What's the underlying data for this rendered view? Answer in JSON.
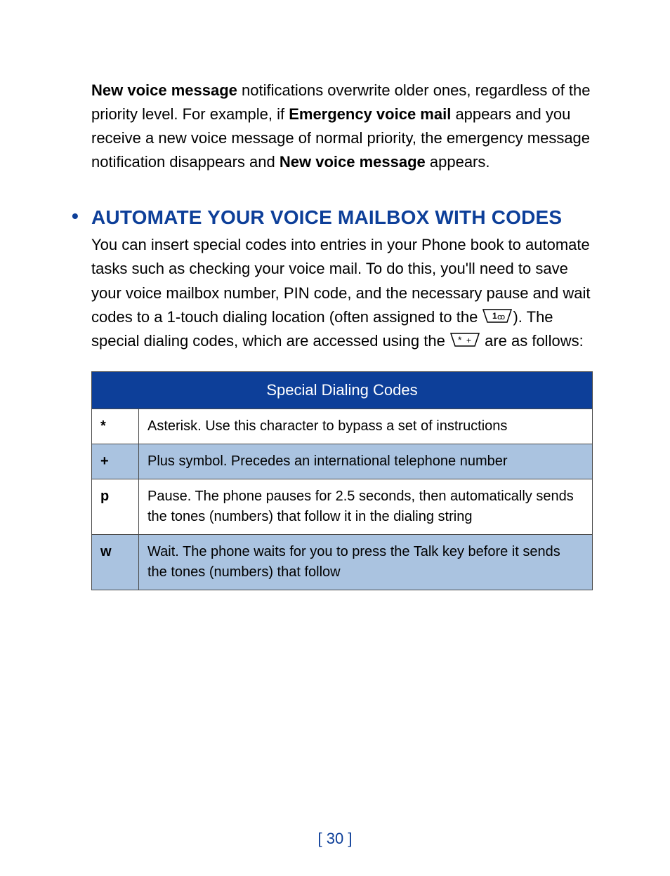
{
  "intro": {
    "seg1_bold": "New voice message",
    "seg2": " notifications overwrite older ones, regardless of the priority level. For example, if ",
    "seg3_bold": "Emergency voice mail",
    "seg4": " appears and you receive a new voice message of normal priority, the emergency message notification disappears and ",
    "seg5_bold": "New voice message",
    "seg6": " appears."
  },
  "section": {
    "heading": "AUTOMATE YOUR VOICE MAILBOX WITH CODES",
    "body_pre": "You can insert special codes into entries in your Phone book to automate tasks such as checking your voice mail. To do this, you'll need to save your voice mailbox number, PIN code, and the necessary pause and wait codes to a 1-touch dialing location (often assigned to the ",
    "body_mid": "). The special dialing codes, which are accessed using the ",
    "body_post": " are as follows:"
  },
  "table": {
    "header": "Special Dialing Codes",
    "rows": [
      {
        "code": "*",
        "desc": "Asterisk. Use this character to bypass a set of instructions"
      },
      {
        "code": "+",
        "desc": "Plus symbol. Precedes an international telephone number"
      },
      {
        "code": "p",
        "desc": "Pause. The phone pauses for 2.5 seconds, then automatically sends the tones (numbers) that follow it in the dialing string"
      },
      {
        "code": "w",
        "desc": "Wait. The phone waits for you to press the Talk key before it sends the tones (numbers) that follow"
      }
    ]
  },
  "page_number": "[ 30 ]"
}
